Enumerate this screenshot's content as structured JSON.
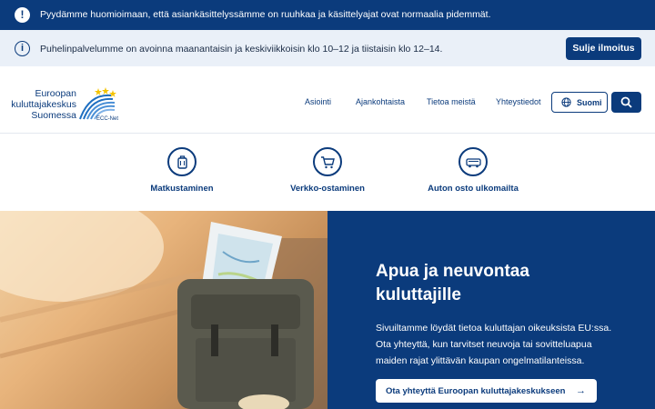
{
  "alert": {
    "text": "Pyydämme huomioimaan, että asiankäsittelyssämme on ruuhkaa ja käsittelyajat ovat normaalia pidemmät.",
    "icon": "exclamation-icon"
  },
  "notice": {
    "text": "Puhelinpalvelumme on avoinna maanantaisin ja keskiviikkoisin klo 10–12 ja tiistaisin klo 12–14.",
    "icon": "info-icon",
    "close_label": "Sulje ilmoitus"
  },
  "logo": {
    "line1": "Euroopan",
    "line2": "kuluttajakeskus",
    "line3": "Suomessa",
    "badge": "ECC-Net"
  },
  "nav": {
    "items": [
      "Asiointi",
      "Ajankohtaista",
      "Tietoa meistä",
      "Yhteystiedot"
    ],
    "language": "Suomi"
  },
  "categories": [
    {
      "label": "Matkustaminen",
      "icon": "suitcase-icon"
    },
    {
      "label": "Verkko-ostaminen",
      "icon": "shopping-cart-icon"
    },
    {
      "label": "Auton osto ulkomailta",
      "icon": "car-icon"
    }
  ],
  "hero": {
    "title": "Apua ja neuvontaa kuluttajille",
    "text": "Sivuiltamme löydät tietoa kuluttajan oikeuksista EU:ssa. Ota yhteyttä, kun tarvitset neuvoja tai sovitteluapua maiden rajat ylittävän kaupan ongelmatilanteissa.",
    "cta_label": "Ota yhteyttä Euroopan kuluttajakeskukseen"
  },
  "colors": {
    "brand": "#0b3b7c",
    "notice_bg": "#eaf0f8",
    "star": "#f4c300"
  }
}
